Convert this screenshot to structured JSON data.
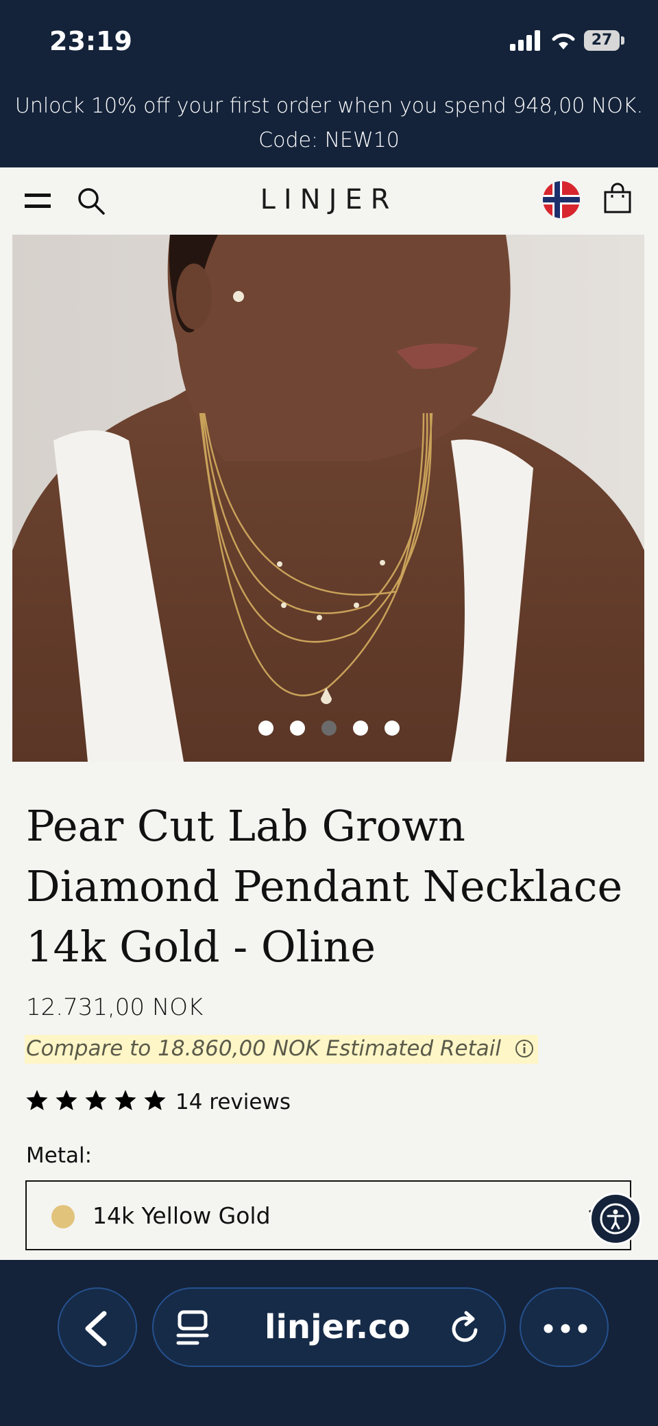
{
  "status_bar": {
    "time": "23:19",
    "battery": "27",
    "signal_icon": "signal-bars-icon",
    "wifi_icon": "wifi-icon"
  },
  "promo": {
    "line1": "Unlock 10% off your first order when you spend 948,00 NOK.",
    "line2": "Code: NEW10"
  },
  "header": {
    "logo": "LINJER",
    "menu_icon": "hamburger-menu-icon",
    "search_icon": "search-icon",
    "region_icon": "norway-flag-icon",
    "cart_icon": "shopping-bag-icon"
  },
  "gallery": {
    "image_count": 5,
    "active_index": 2,
    "image_subject": "woman wearing layered gold necklaces with pear cut pendant"
  },
  "product": {
    "title_line1": "Pear Cut Lab Grown",
    "title_line2": "Diamond Pendant Necklace",
    "title_line3": "14k Gold - Oline",
    "price": "12.731,00 NOK",
    "compare": "Compare to 18.860,00 NOK Estimated Retail",
    "rating": 5,
    "reviews": "14 reviews"
  },
  "metal": {
    "label": "Metal:",
    "selected": "14k Yellow Gold",
    "swatch_color": "#e2c37b"
  },
  "browser_bar": {
    "url": "linjer.co",
    "back_icon": "back-chevron-icon",
    "tabs_icon": "tabs-icon",
    "reload_icon": "reload-icon",
    "more_icon": "more-dots-icon"
  },
  "colors": {
    "navy": "#14233a",
    "background": "#f4f4f1",
    "highlight": "#fff6c7",
    "pill_border": "#25518e"
  }
}
